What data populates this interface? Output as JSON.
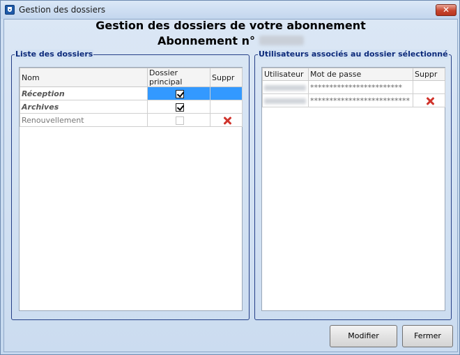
{
  "window": {
    "title": "Gestion des dossiers",
    "close_glyph": "✕"
  },
  "header": {
    "title": "Gestion des dossiers de votre abonnement",
    "subscription_label": "Abonnement n°"
  },
  "folders_group": {
    "label": "Liste des dossiers",
    "columns": [
      "Nom",
      "Dossier principal",
      "Suppr"
    ],
    "rows": [
      {
        "name": "Réception",
        "principal": true,
        "deletable": false
      },
      {
        "name": "Archives",
        "principal": true,
        "deletable": false
      },
      {
        "name": "Renouvellement",
        "principal": false,
        "deletable": true
      }
    ]
  },
  "users_group": {
    "label": "Utilisateurs associés au dossier sélectionné",
    "columns": [
      "Utilisateur",
      "Mot de passe",
      "Suppr"
    ],
    "rows": [
      {
        "password": "************************",
        "deletable": false
      },
      {
        "password": "**************************",
        "deletable": true
      }
    ]
  },
  "buttons": {
    "modify": "Modifier",
    "close": "Fermer"
  },
  "colors": {
    "selection": "#3399ff",
    "delete": "#d0342c",
    "group_border": "#243e87"
  },
  "icons": {
    "app": "trophy-icon",
    "delete": "red-x-icon"
  }
}
